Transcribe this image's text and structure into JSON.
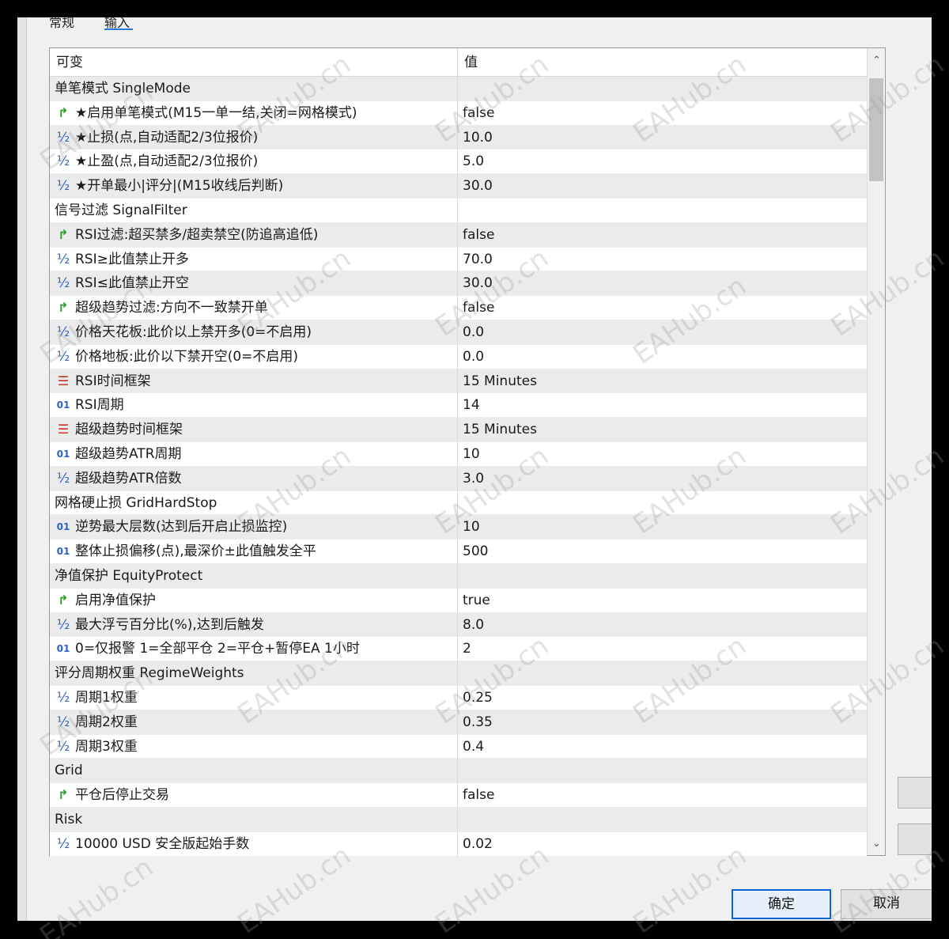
{
  "tabs": [
    {
      "label": "常规"
    },
    {
      "label": "输入"
    }
  ],
  "grid": {
    "header": {
      "variable": "可变",
      "value": "值"
    },
    "rows": [
      {
        "type": "group",
        "name": "单笔模式 SingleMode",
        "value": ""
      },
      {
        "type": "bool",
        "name": "★启用单笔模式(M15一单一结,关闭=网格模式)",
        "value": "false"
      },
      {
        "type": "double",
        "name": "★止损(点,自动适配2/3位报价)",
        "value": "10.0"
      },
      {
        "type": "double",
        "name": "★止盈(点,自动适配2/3位报价)",
        "value": "5.0"
      },
      {
        "type": "double",
        "name": "★开单最小|评分|(M15收线后判断)",
        "value": "30.0"
      },
      {
        "type": "group",
        "name": "信号过滤 SignalFilter",
        "value": ""
      },
      {
        "type": "bool",
        "name": "RSI过滤:超买禁多/超卖禁空(防追高追低)",
        "value": "false"
      },
      {
        "type": "double",
        "name": "RSI≥此值禁止开多",
        "value": "70.0"
      },
      {
        "type": "double",
        "name": "RSI≤此值禁止开空",
        "value": "30.0"
      },
      {
        "type": "bool",
        "name": "超级趋势过滤:方向不一致禁开单",
        "value": "false"
      },
      {
        "type": "double",
        "name": "价格天花板:此价以上禁开多(0=不启用)",
        "value": "0.0"
      },
      {
        "type": "double",
        "name": "价格地板:此价以下禁开空(0=不启用)",
        "value": "0.0"
      },
      {
        "type": "enum",
        "name": "RSI时间框架",
        "value": "15 Minutes"
      },
      {
        "type": "int",
        "name": "RSI周期",
        "value": "14"
      },
      {
        "type": "enum",
        "name": "超级趋势时间框架",
        "value": "15 Minutes"
      },
      {
        "type": "int",
        "name": "超级趋势ATR周期",
        "value": "10"
      },
      {
        "type": "double",
        "name": "超级趋势ATR倍数",
        "value": "3.0"
      },
      {
        "type": "group",
        "name": "网格硬止损 GridHardStop",
        "value": ""
      },
      {
        "type": "int",
        "name": "逆势最大层数(达到后开启止损监控)",
        "value": "10"
      },
      {
        "type": "int",
        "name": "整体止损偏移(点),最深价±此值触发全平",
        "value": "500"
      },
      {
        "type": "group",
        "name": "净值保护 EquityProtect",
        "value": ""
      },
      {
        "type": "bool",
        "name": "启用净值保护",
        "value": "true"
      },
      {
        "type": "double",
        "name": "最大浮亏百分比(%),达到后触发",
        "value": "8.0"
      },
      {
        "type": "int",
        "name": "0=仅报警 1=全部平仓 2=平仓+暂停EA 1小时",
        "value": "2"
      },
      {
        "type": "group",
        "name": "评分周期权重 RegimeWeights",
        "value": ""
      },
      {
        "type": "double",
        "name": "周期1权重",
        "value": "0.25"
      },
      {
        "type": "double",
        "name": "周期2权重",
        "value": "0.35"
      },
      {
        "type": "double",
        "name": "周期3权重",
        "value": "0.4"
      },
      {
        "type": "group",
        "name": "Grid",
        "value": ""
      },
      {
        "type": "bool",
        "name": "平仓后停止交易",
        "value": "false"
      },
      {
        "type": "group",
        "name": "Risk",
        "value": ""
      },
      {
        "type": "double",
        "name": "10000 USD 安全版起始手数",
        "value": "0.02"
      }
    ]
  },
  "icons": {
    "bool": "bool-toggle-icon",
    "double": "double-fraction-icon",
    "int": "integer-01-icon",
    "enum": "enum-list-icon"
  },
  "icon_glyphs": {
    "bool": "↱",
    "double": "½",
    "int": "01",
    "enum": "☰"
  },
  "buttons": {
    "ok": "确定",
    "cancel": "取消"
  },
  "watermark": "EAHub.cn",
  "colors": {
    "accent": "#0a64d4",
    "bool_icon": "#2aa02a",
    "enum_icon": "#cc3333",
    "int_icon": "#2f62c9"
  }
}
